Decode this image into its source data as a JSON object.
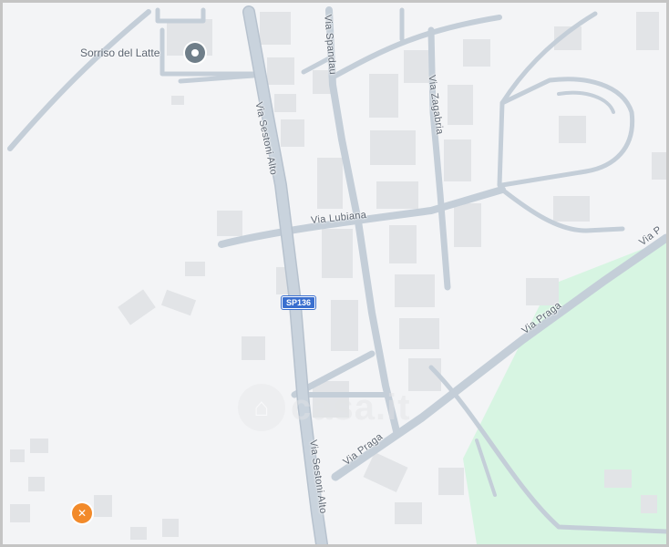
{
  "map": {
    "colors": {
      "land": "#f3f4f6",
      "road": "#c4ced8",
      "road_casing": "#b7c2ce",
      "building": "#e2e4e7",
      "park": "#d7f5e2",
      "poi_gray": "#6f7e89",
      "poi_food": "#f28a2a",
      "shield": "#3a6fcf"
    },
    "streets": [
      {
        "id": "via-sestoni-alto-north",
        "name": "Via Sestoni Alto"
      },
      {
        "id": "via-sestoni-alto-south",
        "name": "Via Sestoni Alto"
      },
      {
        "id": "via-spandau",
        "name": "Via Spandau"
      },
      {
        "id": "via-zagabria",
        "name": "Via Zagabria"
      },
      {
        "id": "via-lubiana",
        "name": "Via Lubiana"
      },
      {
        "id": "via-praga-east",
        "name": "Via Praga"
      },
      {
        "id": "via-praga-west",
        "name": "Via Praga"
      }
    ],
    "road_shield": {
      "label": "SP136"
    },
    "pois": [
      {
        "id": "sorriso-del-latte",
        "label": "Sorriso del Latte",
        "icon": "map-pin-icon"
      },
      {
        "id": "restaurant",
        "label": "",
        "icon": "restaurant-icon"
      }
    ],
    "watermark": {
      "text": "casa.it",
      "icon": "house-icon"
    }
  }
}
